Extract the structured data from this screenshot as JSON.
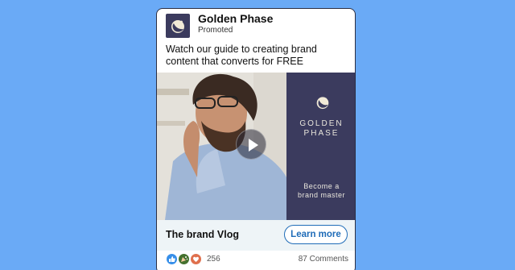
{
  "post": {
    "brand_name": "Golden Phase",
    "promoted_label": "Promoted",
    "caption": "Watch our guide to creating brand content that converts for FREE"
  },
  "media": {
    "panel_title_line1": "GOLDEN",
    "panel_title_line2": "PHASE",
    "panel_tagline_line1": "Become a",
    "panel_tagline_line2": "brand master",
    "play_icon": "play-icon"
  },
  "cta": {
    "title": "The brand Vlog",
    "button_label": "Learn more"
  },
  "social": {
    "reaction_icons": [
      "like-icon",
      "celebrate-icon",
      "love-icon"
    ],
    "reaction_count": "256",
    "comments": "87 Comments"
  },
  "colors": {
    "background": "#6aaaf6",
    "brand_panel": "#3b3b5e",
    "accent": "#1f6cb8",
    "cta_bar": "#eef4f7"
  }
}
